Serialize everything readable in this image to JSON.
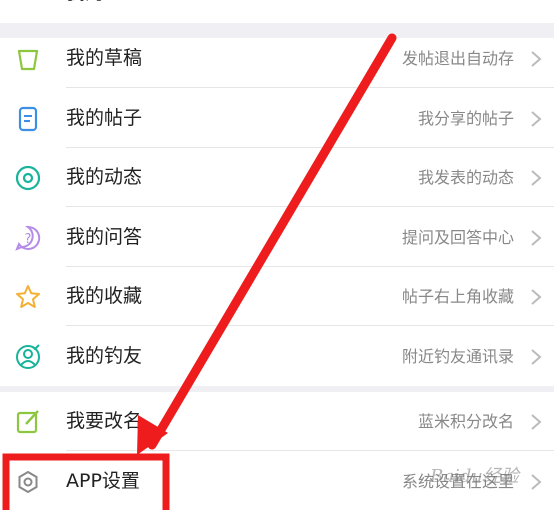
{
  "top_partial": {
    "label": "我的",
    "desc": ""
  },
  "group1": [
    {
      "key": "drafts",
      "label": "我的草稿",
      "desc": "发帖退出自动存",
      "icon": "cup-icon",
      "color": "#8dc63f"
    },
    {
      "key": "posts",
      "label": "我的帖子",
      "desc": "我分享的帖子",
      "icon": "document-icon",
      "color": "#3d8fe6"
    },
    {
      "key": "activity",
      "label": "我的动态",
      "desc": "我发表的动态",
      "icon": "target-icon",
      "color": "#17b39a"
    },
    {
      "key": "qa",
      "label": "我的问答",
      "desc": "提问及回答中心",
      "icon": "question-icon",
      "color": "#b48be8"
    },
    {
      "key": "favorites",
      "label": "我的收藏",
      "desc": "帖子右上角收藏",
      "icon": "star-icon",
      "color": "#f2b134"
    },
    {
      "key": "fishing_friends",
      "label": "我的钓友",
      "desc": "附近钓友通讯录",
      "icon": "user-check-icon",
      "color": "#17b39a"
    }
  ],
  "group2": [
    {
      "key": "rename",
      "label": "我要改名",
      "desc": "蓝米积分改名",
      "icon": "edit-icon",
      "color": "#8dc63f"
    },
    {
      "key": "app_settings",
      "label": "APP设置",
      "desc": "系统设置在这里",
      "icon": "hexagon-gear-icon",
      "color": "#888888"
    }
  ],
  "watermark": "Baidu经验",
  "annotation_color": "#ee1c1c"
}
